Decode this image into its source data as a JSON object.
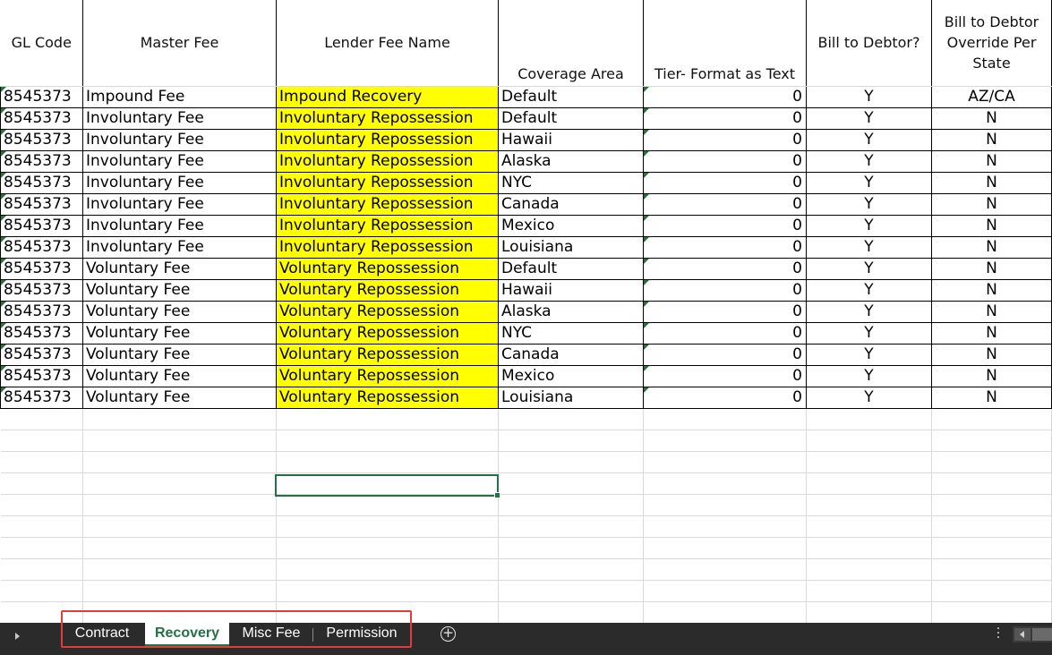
{
  "app": "Excel",
  "columns": {
    "gl_code": "GL Code",
    "master_fee": "Master Fee",
    "lender_fee_name": "Lender Fee Name",
    "coverage_area": "Coverage Area",
    "tier": "Tier- Format as Text",
    "bill_to_debtor": "Bill to Debtor?",
    "bill_override": "Bill to Debtor Override Per State"
  },
  "rows": [
    {
      "gl": "8545373",
      "master": "Impound Fee",
      "lender": "Impound Recovery",
      "area": "Default",
      "tier": "0",
      "bill": "Y",
      "override": "AZ/CA"
    },
    {
      "gl": "8545373",
      "master": "Involuntary Fee",
      "lender": "Involuntary Repossession",
      "area": "Default",
      "tier": "0",
      "bill": "Y",
      "override": "N"
    },
    {
      "gl": "8545373",
      "master": "Involuntary Fee",
      "lender": "Involuntary Repossession",
      "area": "Hawaii",
      "tier": "0",
      "bill": "Y",
      "override": "N"
    },
    {
      "gl": "8545373",
      "master": "Involuntary Fee",
      "lender": "Involuntary Repossession",
      "area": "Alaska",
      "tier": "0",
      "bill": "Y",
      "override": "N"
    },
    {
      "gl": "8545373",
      "master": "Involuntary Fee",
      "lender": "Involuntary Repossession",
      "area": "NYC",
      "tier": "0",
      "bill": "Y",
      "override": "N"
    },
    {
      "gl": "8545373",
      "master": "Involuntary Fee",
      "lender": "Involuntary Repossession",
      "area": "Canada",
      "tier": "0",
      "bill": "Y",
      "override": "N"
    },
    {
      "gl": "8545373",
      "master": "Involuntary Fee",
      "lender": "Involuntary Repossession",
      "area": "Mexico",
      "tier": "0",
      "bill": "Y",
      "override": "N"
    },
    {
      "gl": "8545373",
      "master": "Involuntary Fee",
      "lender": "Involuntary Repossession",
      "area": "Louisiana",
      "tier": "0",
      "bill": "Y",
      "override": "N"
    },
    {
      "gl": "8545373",
      "master": "Voluntary Fee",
      "lender": "Voluntary Repossession",
      "area": "Default",
      "tier": "0",
      "bill": "Y",
      "override": "N"
    },
    {
      "gl": "8545373",
      "master": "Voluntary Fee",
      "lender": "Voluntary Repossession",
      "area": "Hawaii",
      "tier": "0",
      "bill": "Y",
      "override": "N"
    },
    {
      "gl": "8545373",
      "master": "Voluntary Fee",
      "lender": "Voluntary Repossession",
      "area": "Alaska",
      "tier": "0",
      "bill": "Y",
      "override": "N"
    },
    {
      "gl": "8545373",
      "master": "Voluntary Fee",
      "lender": "Voluntary Repossession",
      "area": "NYC",
      "tier": "0",
      "bill": "Y",
      "override": "N"
    },
    {
      "gl": "8545373",
      "master": "Voluntary Fee",
      "lender": "Voluntary Repossession",
      "area": "Canada",
      "tier": "0",
      "bill": "Y",
      "override": "N"
    },
    {
      "gl": "8545373",
      "master": "Voluntary Fee",
      "lender": "Voluntary Repossession",
      "area": "Mexico",
      "tier": "0",
      "bill": "Y",
      "override": "N"
    },
    {
      "gl": "8545373",
      "master": "Voluntary Fee",
      "lender": "Voluntary Repossession",
      "area": "Louisiana",
      "tier": "0",
      "bill": "Y",
      "override": "N"
    }
  ],
  "sheet_tabs": [
    {
      "label": "Contract",
      "active": false
    },
    {
      "label": "Recovery",
      "active": true
    },
    {
      "label": "Misc Fee",
      "active": false
    },
    {
      "label": "Permission",
      "active": false
    }
  ],
  "icons": {
    "scroll_tabs_left": "chevron-right-icon",
    "add_sheet": "plus-circle-icon",
    "more_options": "vertical-ellipsis-icon",
    "scroll_left": "scroll-left-icon"
  },
  "colors": {
    "highlight_fill": "#ffff00",
    "excel_green": "#217346",
    "tab_bar": "#2b2b2b",
    "annotation_box": "#e03c3c"
  }
}
